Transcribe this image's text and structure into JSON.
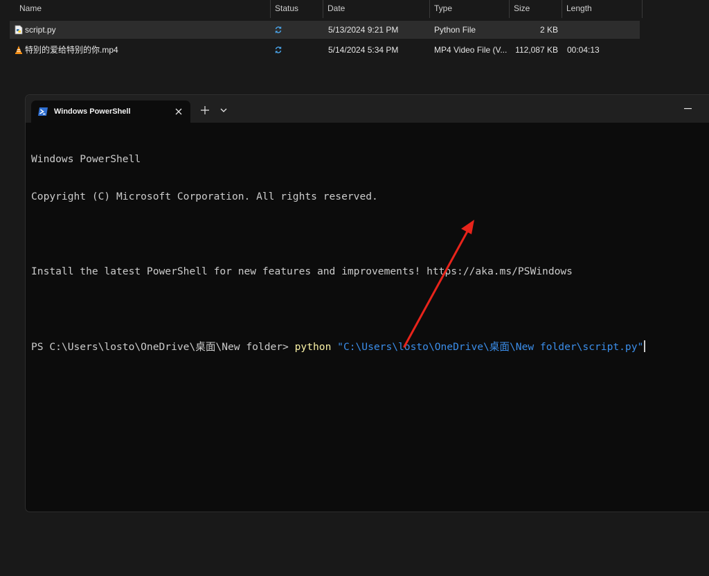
{
  "explorer": {
    "columns": [
      "Name",
      "Status",
      "Date",
      "Type",
      "Size",
      "Length"
    ],
    "files": [
      {
        "name": "script.py",
        "icon": "python-file-icon",
        "status": "sync-icon",
        "date": "5/13/2024 9:21 PM",
        "type": "Python File",
        "size": "2 KB",
        "length": ""
      },
      {
        "name": "特别的爱给特别的你.mp4",
        "icon": "vlc-cone-icon",
        "status": "sync-icon",
        "date": "5/14/2024 5:34 PM",
        "type": "MP4 Video File (V...",
        "size": "112,087 KB",
        "length": "00:04:13"
      }
    ]
  },
  "terminal": {
    "tab_title": "Windows PowerShell",
    "lines": {
      "header1": "Windows PowerShell",
      "header2": "Copyright (C) Microsoft Corporation. All rights reserved.",
      "install": "Install the latest PowerShell for new features and improvements! https://aka.ms/PSWindows",
      "prompt": "PS C:\\Users\\losto\\OneDrive\\桌面\\New folder> ",
      "command": "python",
      "argument": "\"C:\\Users\\losto\\OneDrive\\桌面\\New folder\\script.py\""
    }
  },
  "colors": {
    "command": "#f9f1a5",
    "argument": "#3b8eea",
    "arrow": "#e8241b"
  }
}
